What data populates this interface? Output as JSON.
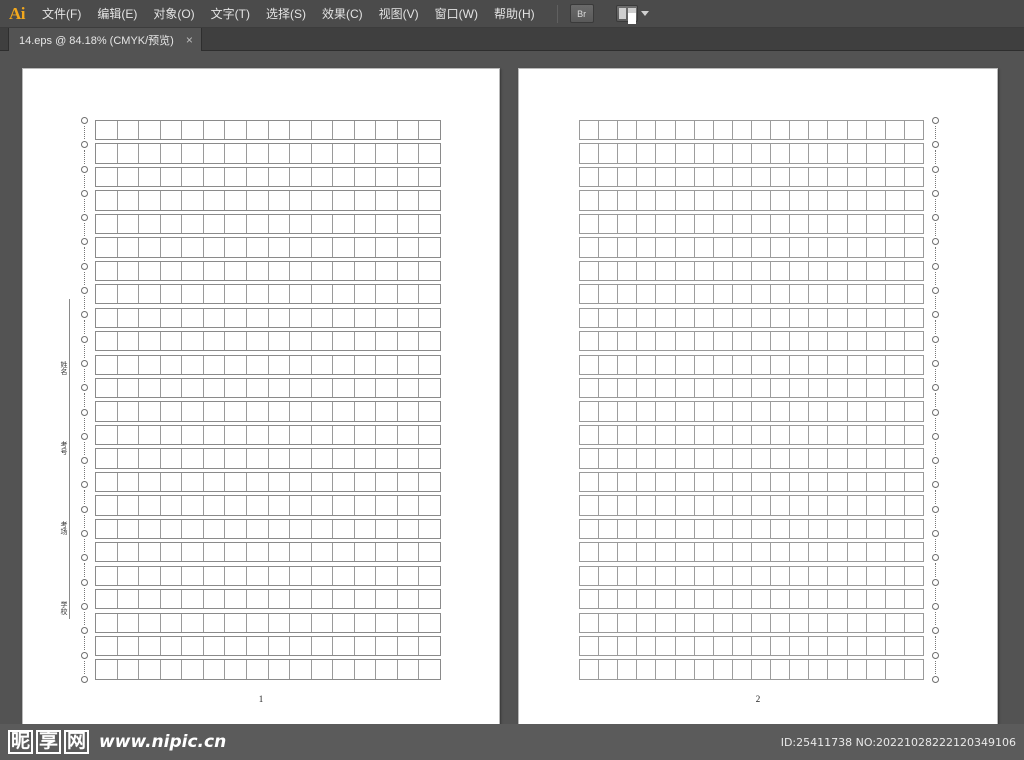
{
  "app": {
    "name": "Ai",
    "logo_color": "#f2a81d"
  },
  "menubar": {
    "items": [
      {
        "label": "文件(F)",
        "name": "menu-file"
      },
      {
        "label": "编辑(E)",
        "name": "menu-edit"
      },
      {
        "label": "对象(O)",
        "name": "menu-object"
      },
      {
        "label": "文字(T)",
        "name": "menu-type"
      },
      {
        "label": "选择(S)",
        "name": "menu-select"
      },
      {
        "label": "效果(C)",
        "name": "menu-effect"
      },
      {
        "label": "视图(V)",
        "name": "menu-view"
      },
      {
        "label": "窗口(W)",
        "name": "menu-window"
      },
      {
        "label": "帮助(H)",
        "name": "menu-help"
      }
    ],
    "bridge_button_label": "Br",
    "arrange_documents_label": ""
  },
  "tabbar": {
    "tab_label": "14.eps @ 84.18% (CMYK/预览)",
    "close_label": "×",
    "document_name": "14.eps",
    "zoom_level": "84.18%",
    "color_mode": "CMYK",
    "view_mode": "预览"
  },
  "artboards": [
    {
      "page_number": "1",
      "grid": {
        "rows": 24,
        "columns": 16
      },
      "field_labels": [
        "姓名",
        "考号",
        "考场",
        "学校"
      ],
      "hole_count": 24,
      "holes_side": "left"
    },
    {
      "page_number": "2",
      "grid": {
        "rows": 24,
        "columns": 18
      },
      "field_labels": [],
      "hole_count": 24,
      "holes_side": "right"
    }
  ],
  "watermark": {
    "logo_chars": [
      "昵",
      "享",
      "网"
    ],
    "url": "www.nipic.cn",
    "id_text": "ID:25411738 NO:20221028222120349106"
  },
  "colors": {
    "chrome": "#4b4b4b",
    "canvas": "#535353",
    "tabbar": "#3f3f3f",
    "accent": "#f2a81d",
    "grid_line": "#8d8d8d",
    "paper": "#ffffff"
  }
}
